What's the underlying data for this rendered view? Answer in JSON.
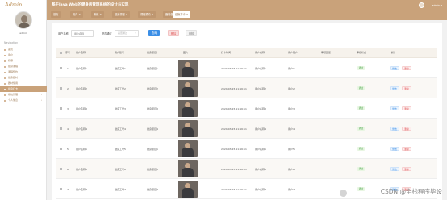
{
  "sidebar": {
    "logo": "Admin",
    "admin_name": "admin",
    "nav_caption": "Navigation",
    "items": [
      {
        "label": "首页",
        "active": false
      },
      {
        "label": "用户",
        "active": false
      },
      {
        "label": "教练",
        "active": false
      },
      {
        "label": "健身课程",
        "active": false
      },
      {
        "label": "课程预约",
        "active": false
      },
      {
        "label": "健身器材",
        "active": false
      },
      {
        "label": "器材借用",
        "active": false
      },
      {
        "label": "健身打卡",
        "active": true
      },
      {
        "label": "系统管理",
        "active": false,
        "caret": "›"
      },
      {
        "label": "个人信息",
        "active": false,
        "caret": "›"
      }
    ]
  },
  "header": {
    "title": "基于Java Web的健身房管理系统的设计与实现",
    "tabs": [
      {
        "label": "首页",
        "active": false
      },
      {
        "label": "用户 ×",
        "active": false
      },
      {
        "label": "教练 ×",
        "active": false
      },
      {
        "label": "健身课程 ×",
        "active": false
      },
      {
        "label": "课程预约 ×",
        "active": false
      },
      {
        "label": "器材借用 ×",
        "active": false
      },
      {
        "label": "健身打卡 ×",
        "active": true
      }
    ],
    "user_name": "admin ▾"
  },
  "search": {
    "label1": "用户名称",
    "placeholder1": "用户名称",
    "label2": "是否通过",
    "placeholder2": "是否通过",
    "search_btn": "查询",
    "delete_btn": "删除",
    "batch_btn": "审核"
  },
  "table": {
    "headers": [
      "序号",
      "用户名称",
      "用户账号",
      "健身项目",
      "图片",
      "打卡时间",
      "用户名称",
      "用户账户",
      "审核回复",
      "审核状态",
      "操作"
    ],
    "rows": [
      {
        "idx": "1",
        "name": "用户名称1",
        "account": "健身工号1",
        "project": "健身项目1",
        "time": "2024-03-15 11:16:51",
        "uname": "用户名称1",
        "uacc": "用户1",
        "status": "通过",
        "edit": "修改",
        "del": "删除"
      },
      {
        "idx": "2",
        "name": "用户名称2",
        "account": "健身工号2",
        "project": "健身项目2",
        "time": "2024-03-15 11:16:51",
        "uname": "用户名称2",
        "uacc": "用户2",
        "status": "通过",
        "edit": "修改",
        "del": "删除"
      },
      {
        "idx": "3",
        "name": "用户名称3",
        "account": "健身工号3",
        "project": "健身项目3",
        "time": "2024-03-15 11:16:51",
        "uname": "用户名称3",
        "uacc": "用户3",
        "status": "通过",
        "edit": "修改",
        "del": "删除"
      },
      {
        "idx": "4",
        "name": "用户名称4",
        "account": "健身工号4",
        "project": "健身项目4",
        "time": "2024-03-15 11:16:51",
        "uname": "用户名称4",
        "uacc": "用户4",
        "status": "通过",
        "edit": "修改",
        "del": "删除"
      },
      {
        "idx": "5",
        "name": "用户名称5",
        "account": "健身工号5",
        "project": "健身项目5",
        "time": "2024-03-15 11:16:51",
        "uname": "用户名称5",
        "uacc": "用户5",
        "status": "通过",
        "edit": "修改",
        "del": "删除"
      },
      {
        "idx": "6",
        "name": "用户名称6",
        "account": "健身工号6",
        "project": "健身项目6",
        "time": "2024-03-15 11:16:51",
        "uname": "用户名称6",
        "uacc": "用户6",
        "status": "通过",
        "edit": "修改",
        "del": "删除"
      },
      {
        "idx": "7",
        "name": "用户名称7",
        "account": "健身工号7",
        "project": "健身项目7",
        "time": "2024-03-15 11:16:51",
        "uname": "用户名称7",
        "uacc": "用户7",
        "status": "通过",
        "edit": "修改",
        "del": "删除"
      }
    ]
  },
  "watermark": "CSDN @全栈程序毕设",
  "colors": {
    "accent": "#c9a27a",
    "primary": "#3a8ee6",
    "danger": "#e05b5b",
    "success": "#4aa34a"
  }
}
